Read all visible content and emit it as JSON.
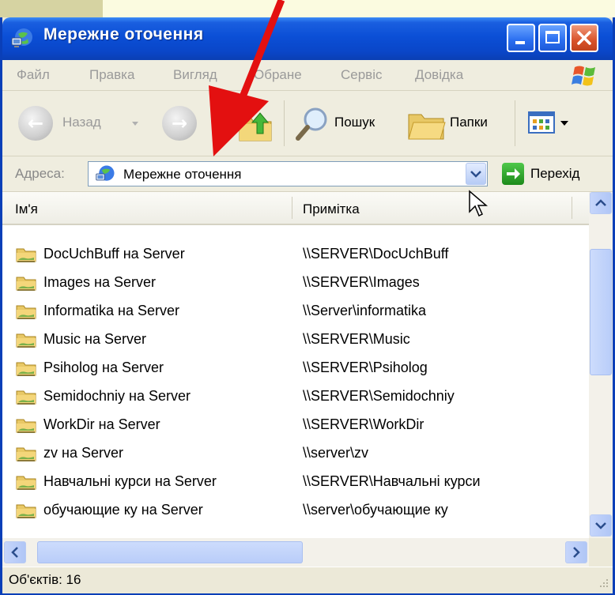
{
  "window": {
    "title": "Мережне оточення"
  },
  "menu": [
    "Файл",
    "Правка",
    "Вигляд",
    "Обране",
    "Сервіс",
    "Довідка"
  ],
  "toolbar": {
    "back_label": "Назад",
    "search_label": "Пошук",
    "folders_label": "Папки"
  },
  "address": {
    "label": "Адреса:",
    "value": "Мережне оточення",
    "go_label": "Перехід"
  },
  "columns": {
    "name": "Ім'я",
    "note": "Примітка"
  },
  "items": [
    {
      "name": "DocUchBuff на Server",
      "note": "\\\\SERVER\\DocUchBuff"
    },
    {
      "name": "Images на Server",
      "note": "\\\\SERVER\\Images"
    },
    {
      "name": "Informatika на Server",
      "note": "\\\\Server\\informatika"
    },
    {
      "name": "Music на Server",
      "note": "\\\\SERVER\\Music"
    },
    {
      "name": "Psiholog на Server",
      "note": "\\\\SERVER\\Psiholog"
    },
    {
      "name": "Semidochniy на Server",
      "note": "\\\\SERVER\\Semidochniy"
    },
    {
      "name": "WorkDir на Server",
      "note": "\\\\SERVER\\WorkDir"
    },
    {
      "name": "zv на Server",
      "note": "\\\\server\\zv"
    },
    {
      "name": "Навчальні курси на Server",
      "note": "\\\\SERVER\\Навчальні курси"
    },
    {
      "name": "обучающие ку на Server",
      "note": "\\\\server\\обучающие ку"
    }
  ],
  "status": {
    "text": "Об'єктів: 16"
  },
  "colors": {
    "title_blue": "#0b4fd6",
    "annotation_arrow": "#e31010"
  },
  "icons": [
    "network-places-icon",
    "windows-logo-icon",
    "back-icon",
    "forward-icon",
    "up-folder-icon",
    "search-icon",
    "folders-icon",
    "views-icon",
    "go-icon",
    "network-share-icon",
    "mouse-cursor-icon"
  ]
}
